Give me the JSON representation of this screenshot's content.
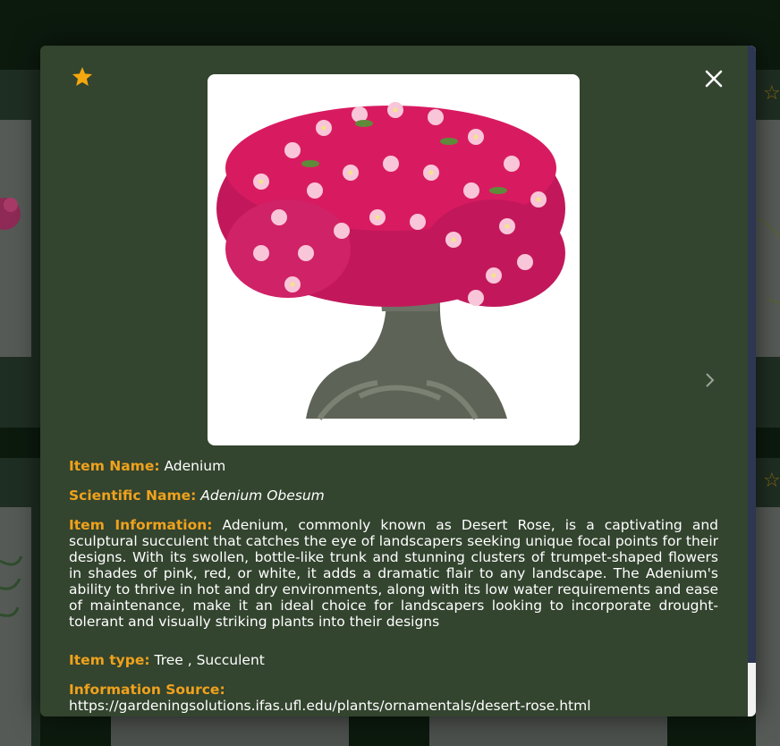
{
  "modal": {
    "favorite_icon": "star-icon",
    "close_icon": "close-icon",
    "next_icon": "chevron-right-icon",
    "image_alt": "Adenium",
    "item_name_label": "Item Name:",
    "item_name": "Adenium",
    "scientific_name_label": "Scientific Name:",
    "scientific_name": "Adenium Obesum",
    "item_information_label": "Item Information:",
    "item_information": "Adenium, commonly known as Desert Rose, is a captivating and sculptural succulent that catches the eye of landscapers seeking unique focal points for their designs. With its swollen, bottle-like trunk and stunning clusters of trumpet-shaped flowers in shades of pink, red, or white, it adds a dramatic flair to any landscape. The Adenium's ability to thrive in hot and dry environments, along with its low water requirements and ease of maintenance, make it an ideal choice for landscapers looking to incorporate drought-tolerant and visually striking plants into their designs",
    "item_type_label": "Item type:",
    "item_type": "Tree , Succulent",
    "information_source_label": "Information Source:",
    "information_source": "https://gardeningsolutions.ifas.ufl.edu/plants/ornamentals/desert-rose.html"
  },
  "colors": {
    "modal_bg": "#33442f",
    "label": "#f0a21c",
    "star": "#f5a70f",
    "text": "#ffffff"
  }
}
